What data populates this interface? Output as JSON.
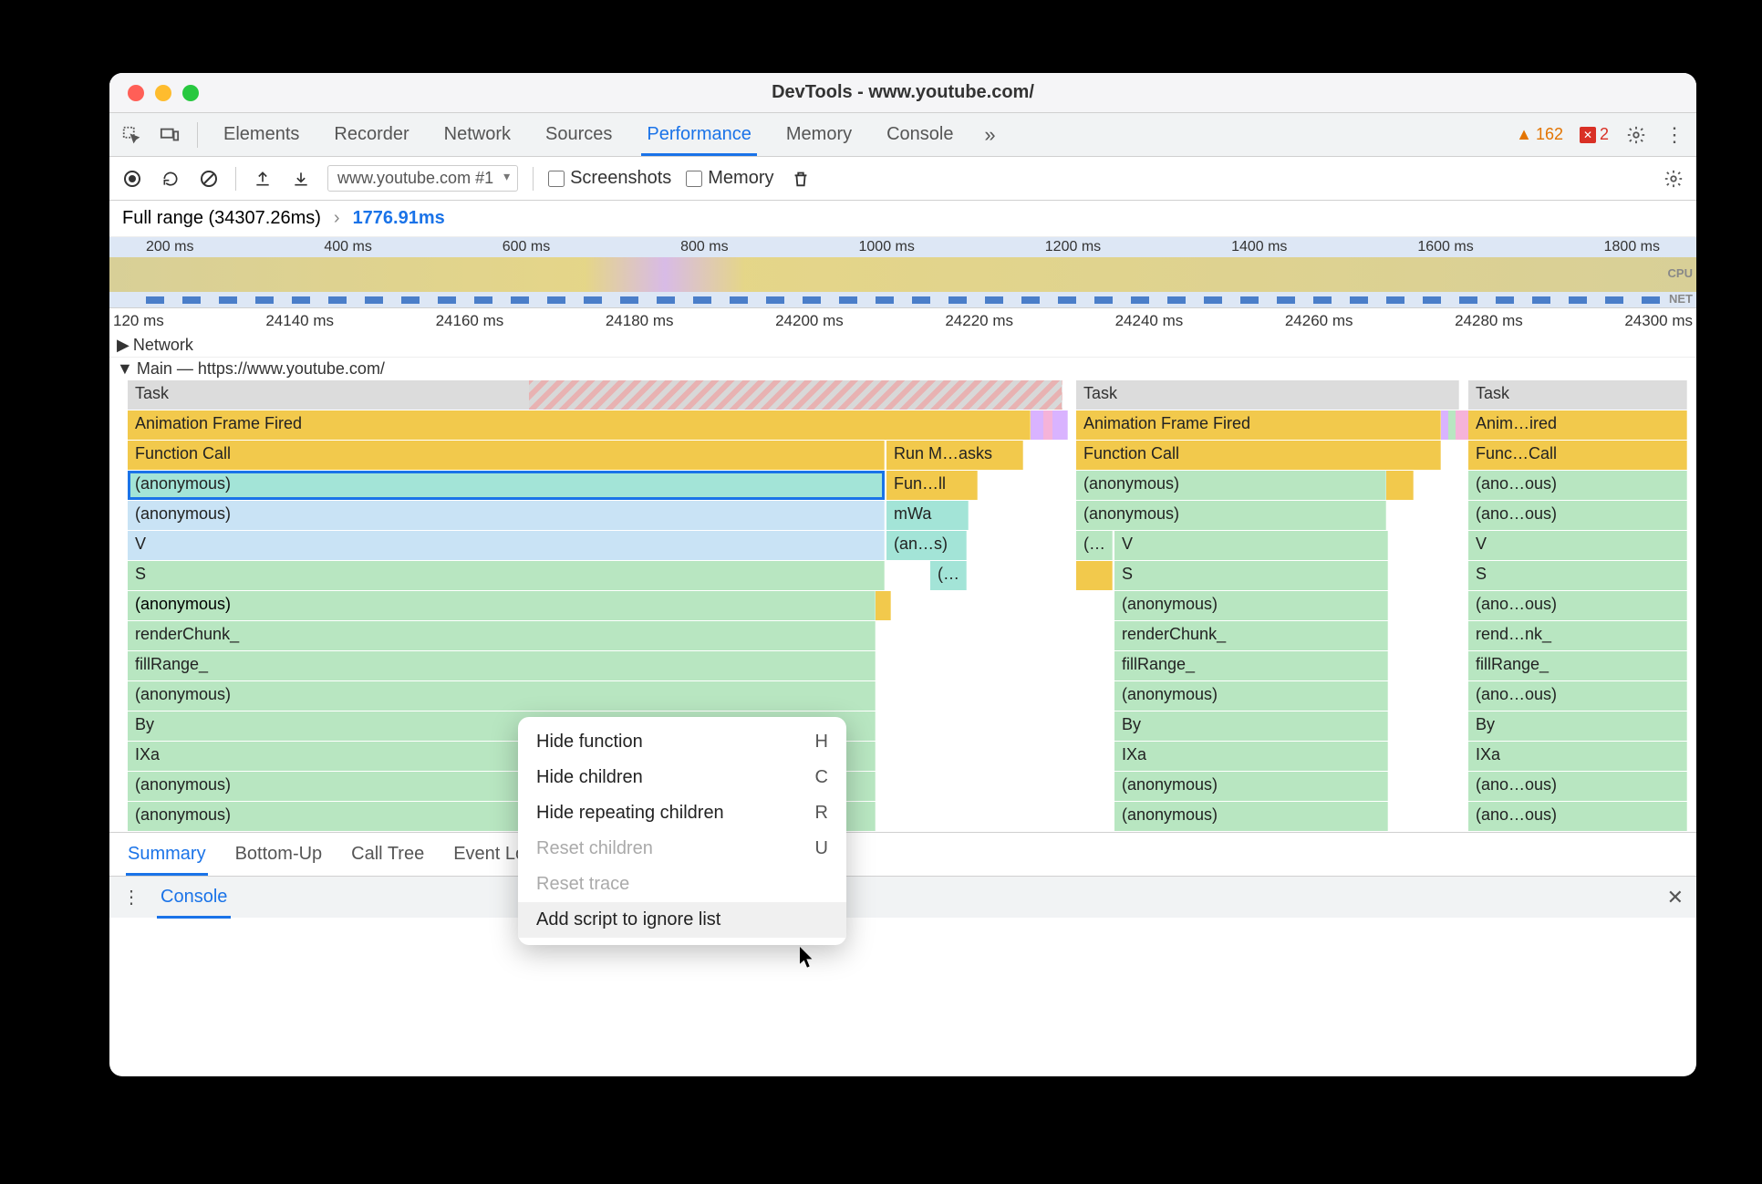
{
  "window": {
    "title": "DevTools - www.youtube.com/"
  },
  "tabs": [
    "Elements",
    "Recorder",
    "Network",
    "Sources",
    "Performance",
    "Memory",
    "Console"
  ],
  "tabs_active": "Performance",
  "badges": {
    "warnings": 162,
    "errors": 2
  },
  "toolbar": {
    "profile_select": "www.youtube.com #1",
    "checkbox_screenshots": "Screenshots",
    "checkbox_memory": "Memory"
  },
  "breadcrumb": {
    "full": "Full range (34307.26ms)",
    "selected": "1776.91ms"
  },
  "overview": {
    "ticks": [
      "200 ms",
      "400 ms",
      "600 ms",
      "800 ms",
      "1000 ms",
      "1200 ms",
      "1400 ms",
      "1600 ms",
      "1800 ms"
    ],
    "cpu_label": "CPU",
    "net_label": "NET"
  },
  "ruler": [
    "120 ms",
    "24140 ms",
    "24160 ms",
    "24180 ms",
    "24200 ms",
    "24220 ms",
    "24240 ms",
    "24260 ms",
    "24280 ms",
    "24300 ms"
  ],
  "tracks": {
    "network": "Network",
    "main": "Main — https://www.youtube.com/"
  },
  "flame": {
    "col1": {
      "task": "Task",
      "aff": "Animation Frame Fired",
      "fc": "Function Call",
      "run": "Run M…asks",
      "anon1": "(anonymous)",
      "funll": "Fun…ll",
      "anon2": "(anonymous)",
      "mwa": "mWa",
      "v": "V",
      "ans": "(an…s)",
      "s": "S",
      "paren": "(…",
      "anon3": "(anonymous)",
      "rc": "renderChunk_",
      "fr": "fillRange_",
      "anon4": "(anonymous)",
      "by": "By",
      "ixa": "IXa",
      "anon5": "(anonymous)",
      "anon6": "(anonymous)"
    },
    "col2": {
      "task": "Task",
      "aff": "Animation Frame Fired",
      "fc": "Function Call",
      "anon1": "(anonymous)",
      "anon2": "(anonymous)",
      "pp": "(…",
      "v": "V",
      "s": "S",
      "anon3": "(anonymous)",
      "rc": "renderChunk_",
      "fr": "fillRange_",
      "anon4": "(anonymous)",
      "by": "By",
      "ixa": "IXa",
      "anon5": "(anonymous)",
      "anon6": "(anonymous)"
    },
    "col3": {
      "task": "Task",
      "aff": "Anim…ired",
      "fc": "Func…Call",
      "anon1": "(ano…ous)",
      "anon2": "(ano…ous)",
      "v": "V",
      "s": "S",
      "anon3": "(ano…ous)",
      "rc": "rend…nk_",
      "fr": "fillRange_",
      "anon4": "(ano…ous)",
      "by": "By",
      "ixa": "IXa",
      "anon5": "(ano…ous)",
      "anon6": "(ano…ous)"
    }
  },
  "context_menu": [
    {
      "label": "Hide function",
      "key": "H",
      "disabled": false,
      "hover": false
    },
    {
      "label": "Hide children",
      "key": "C",
      "disabled": false,
      "hover": false
    },
    {
      "label": "Hide repeating children",
      "key": "R",
      "disabled": false,
      "hover": false
    },
    {
      "label": "Reset children",
      "key": "U",
      "disabled": true,
      "hover": false
    },
    {
      "label": "Reset trace",
      "key": "",
      "disabled": true,
      "hover": false
    },
    {
      "label": "Add script to ignore list",
      "key": "",
      "disabled": false,
      "hover": true
    }
  ],
  "bottom_tabs": [
    "Summary",
    "Bottom-Up",
    "Call Tree",
    "Event Log"
  ],
  "bottom_active": "Summary",
  "drawer": {
    "tab": "Console"
  }
}
